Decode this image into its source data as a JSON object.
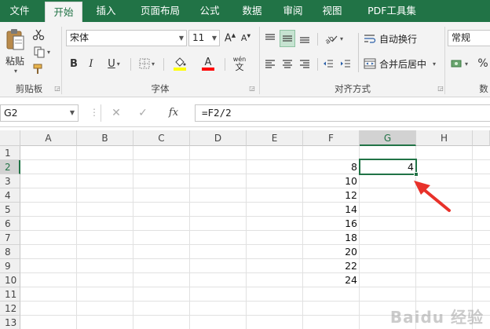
{
  "tabs": [
    {
      "label": "文件",
      "active": false
    },
    {
      "label": "开始",
      "active": true
    },
    {
      "label": "插入",
      "active": false
    },
    {
      "label": "页面布局",
      "active": false
    },
    {
      "label": "公式",
      "active": false
    },
    {
      "label": "数据",
      "active": false
    },
    {
      "label": "审阅",
      "active": false
    },
    {
      "label": "视图",
      "active": false
    },
    {
      "label": "PDF工具集",
      "active": false
    }
  ],
  "ribbon": {
    "clipboard": {
      "paste_label": "粘贴",
      "group_label": "剪贴板"
    },
    "font": {
      "font_name": "宋体",
      "font_size": "11",
      "bold": "B",
      "italic": "I",
      "underline": "U",
      "group_label": "字体",
      "phonetic": "wén",
      "phonetic_char": "文"
    },
    "alignment": {
      "wrap_text": "自动换行",
      "merge_center": "合并后居中",
      "group_label": "对齐方式"
    },
    "number": {
      "format": "常规",
      "percent": "%",
      "group_label_partial": "数"
    },
    "font_color": "#ff0000",
    "fill_color": "#ffff00"
  },
  "formula_bar": {
    "name_box": "G2",
    "fx": "fx",
    "formula": "=F2/2"
  },
  "grid": {
    "columns": [
      "A",
      "B",
      "C",
      "D",
      "E",
      "F",
      "G",
      "H"
    ],
    "rows": [
      "1",
      "2",
      "3",
      "4",
      "5",
      "6",
      "7",
      "8",
      "9",
      "10",
      "11",
      "12",
      "13"
    ],
    "selected_column": "G",
    "selected_row": "2",
    "f_values": [
      "8",
      "10",
      "12",
      "14",
      "16",
      "18",
      "20",
      "22",
      "24"
    ],
    "g2_value": "4"
  },
  "accent_color": "#217346",
  "annotation_color": "#e8312a",
  "watermark": "Baidu 经验"
}
